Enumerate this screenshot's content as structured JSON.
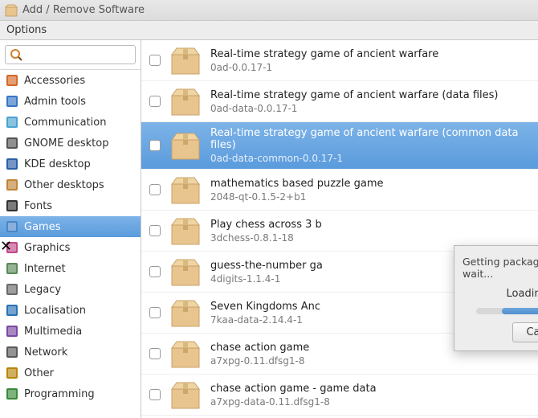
{
  "window": {
    "title": "Add / Remove Software"
  },
  "menu": {
    "options": "Options"
  },
  "search": {
    "placeholder": ""
  },
  "categories": [
    {
      "name": "accessories",
      "label": "Accessories",
      "icon": "accessories"
    },
    {
      "name": "admin-tools",
      "label": "Admin tools",
      "icon": "admin"
    },
    {
      "name": "communication",
      "label": "Communication",
      "icon": "comm"
    },
    {
      "name": "gnome-desktop",
      "label": "GNOME desktop",
      "icon": "gnome"
    },
    {
      "name": "kde-desktop",
      "label": "KDE desktop",
      "icon": "kde"
    },
    {
      "name": "other-desktops",
      "label": "Other desktops",
      "icon": "desktops"
    },
    {
      "name": "fonts",
      "label": "Fonts",
      "icon": "fonts"
    },
    {
      "name": "games",
      "label": "Games",
      "icon": "games",
      "selected": true
    },
    {
      "name": "graphics",
      "label": "Graphics",
      "icon": "graphics"
    },
    {
      "name": "internet",
      "label": "Internet",
      "icon": "internet"
    },
    {
      "name": "legacy",
      "label": "Legacy",
      "icon": "legacy"
    },
    {
      "name": "localisation",
      "label": "Localisation",
      "icon": "local"
    },
    {
      "name": "multimedia",
      "label": "Multimedia",
      "icon": "multimedia"
    },
    {
      "name": "network",
      "label": "Network",
      "icon": "network"
    },
    {
      "name": "other",
      "label": "Other",
      "icon": "other"
    },
    {
      "name": "programming",
      "label": "Programming",
      "icon": "programming"
    }
  ],
  "packages": [
    {
      "name": "Real-time strategy game of ancient warfare",
      "version": "0ad-0.0.17-1"
    },
    {
      "name": "Real-time strategy game of ancient warfare (data files)",
      "version": "0ad-data-0.0.17-1"
    },
    {
      "name": "Real-time strategy game of ancient warfare (common data files)",
      "version": "0ad-data-common-0.0.17-1",
      "selected": true
    },
    {
      "name": "mathematics based puzzle game",
      "version": "2048-qt-0.1.5-2+b1"
    },
    {
      "name": "Play chess across 3 b",
      "version": "3dchess-0.8.1-18"
    },
    {
      "name": "guess-the-number ga",
      "version": "4digits-1.1.4-1"
    },
    {
      "name": "Seven Kingdoms Anc",
      "version": "7kaa-data-2.14.4-1"
    },
    {
      "name": "chase action game",
      "version": "a7xpg-0.11.dfsg1-8"
    },
    {
      "name": "chase action game - game data",
      "version": "a7xpg-data-0.11.dfsg1-8"
    }
  ],
  "dialog": {
    "title": "Getting package data - please wait...",
    "message": "Loading cache",
    "cancel": "Cancel"
  }
}
